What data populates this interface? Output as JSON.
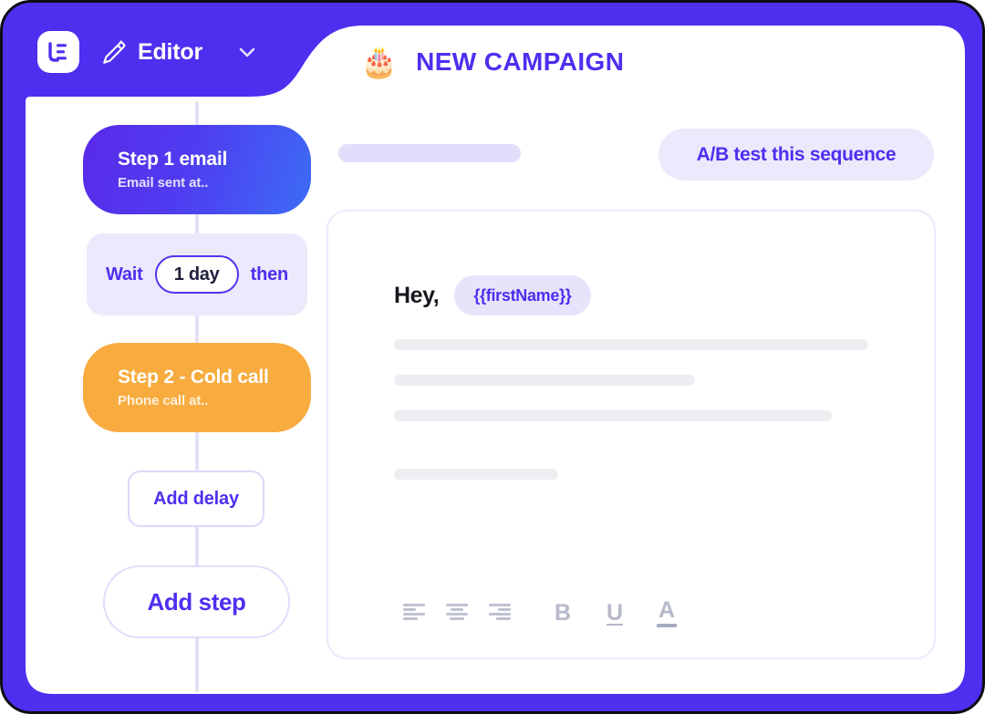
{
  "app": {
    "frame_border_color": "#0d0d12",
    "brand_purple": "#4f2ef0",
    "accent_orange": "#f8ab3e",
    "lavender_surface": "#ece9fc"
  },
  "header": {
    "logo_icon": "le-monogram-logo-icon",
    "pencil_icon": "pencil-icon",
    "tab_label": "Editor",
    "chevron_icon": "chevron-down-icon",
    "campaign_emoji": "🎂",
    "campaign_emoji_name": "birthday-cake-icon",
    "campaign_title": "NEW CAMPAIGN"
  },
  "sequence": {
    "steps": [
      {
        "title": "Step 1 email",
        "subtitle": "Email sent at..",
        "type": "email",
        "color": "#4f2ef0"
      },
      {
        "title": "Step 2 - Cold call",
        "subtitle": "Phone call at..",
        "type": "call",
        "color": "#f8ab3e"
      }
    ],
    "wait": {
      "prefix_label": "Wait",
      "duration_value": "1 day",
      "suffix_label": "then"
    },
    "add_delay_label": "Add delay",
    "add_step_label": "Add step"
  },
  "right_pane": {
    "ab_test_label": "A/B test this sequence",
    "subject_placeholder_width": 200,
    "email": {
      "greeting": "Hey,",
      "merge_tag": "{{firstName}}",
      "body_placeholder_widths": [
        520,
        330,
        480,
        180
      ],
      "body_placeholder_gaps": [
        0,
        27,
        27,
        52
      ]
    },
    "toolbar": [
      {
        "name": "align-left-icon",
        "label": ""
      },
      {
        "name": "align-center-icon",
        "label": ""
      },
      {
        "name": "align-right-icon",
        "label": ""
      },
      {
        "name": "bold-icon",
        "label": "B"
      },
      {
        "name": "underline-icon",
        "label": "U"
      },
      {
        "name": "text-color-icon",
        "label": "A"
      }
    ]
  }
}
